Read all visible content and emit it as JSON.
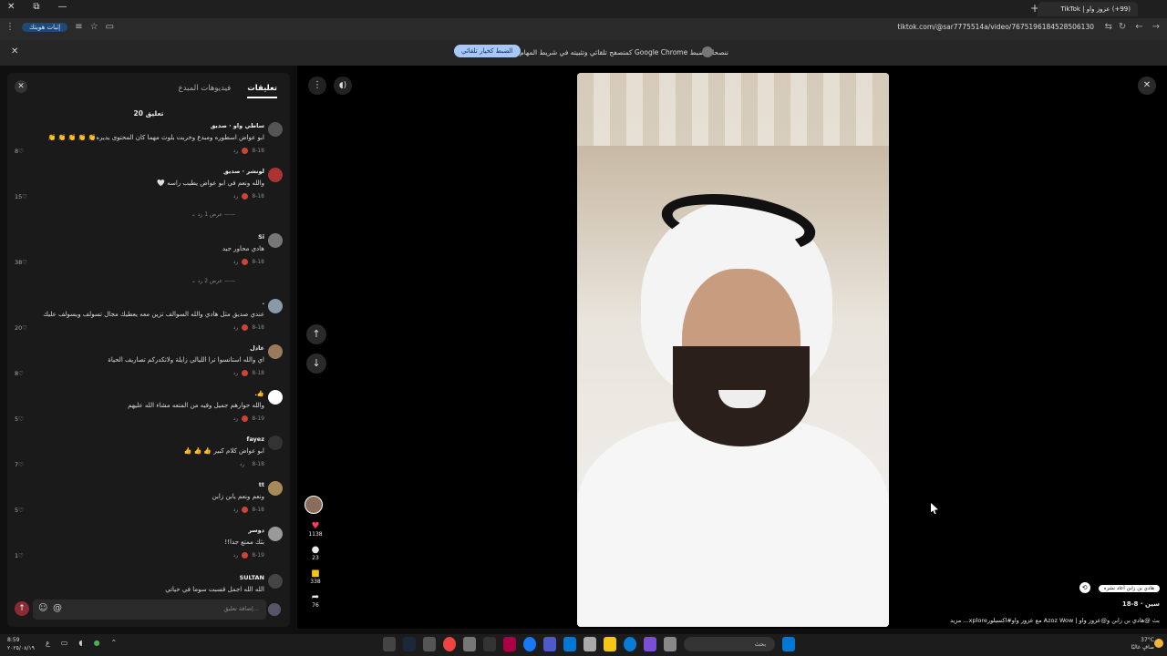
{
  "browser": {
    "tab_title": "(99+) عزوز واو | TikTok",
    "url": "tiktok.com/@sar7775514a/video/7675196184528506130",
    "verify_label": "إثبات هويتك"
  },
  "notification": {
    "message": "ننصحك بضبط Google Chrome كمتصفح تلقائي وتثبيته في شريط المهام",
    "button": "الضبط كخيار تلقائي"
  },
  "comments_panel": {
    "tab_comments": "تعليقات",
    "tab_creator_videos": "فيديوهات المبدع",
    "count_label": "20 تعليق",
    "reply_label": "رد",
    "input_placeholder": "إضافة تعليق...",
    "comments": [
      {
        "name": "ساطي واو · صديق",
        "text": "ابو عواض اسطوره ومبدع وخربت بلوث مهما كان المحتوى يديره👏 👏 👏 👏 👏",
        "date": "8-18",
        "likes": "8"
      },
      {
        "name": "لونشر · صديق",
        "text": "والله ونعم في ابو عواض يطيب راسه 🤍",
        "date": "8-18",
        "likes": "15",
        "replies": "عرض 1 رد"
      },
      {
        "name": "Si",
        "text": "هادي محاور جيد",
        "date": "8-18",
        "likes": "38",
        "replies": "عرض 2 رد"
      },
      {
        "name": ".",
        "text": "عندي صديق مثل هادي والله السوالف تزين معه يعطيك مجال تسولف ويسولف عليك",
        "date": "8-18",
        "likes": "20"
      },
      {
        "name": "عادل",
        "text": "اي والله استانسوا ترا الليالي زايلة ولاتكدركم تصاريف الحياة",
        "date": "8-18",
        "likes": "8"
      },
      {
        "name": "👍.",
        "text": "والله حوارهم جميل وفيه من المتعه مشاء الله عليهم",
        "date": "8-19",
        "likes": "5"
      },
      {
        "name": "fayez",
        "text": "ابو عواض كلام كبير 👍 👍 👍",
        "date": "8-18",
        "likes": "7"
      },
      {
        "name": "tt",
        "text": "ونعم ونعم يابن زابن",
        "date": "8-18",
        "likes": "5"
      },
      {
        "name": "دوسر",
        "text": "بثك ممتع جدا!!",
        "date": "8-19",
        "likes": "1"
      },
      {
        "name": "SULTAN",
        "text": "الله الله اجمل قسبت سوما في حياتي",
        "date": "",
        "likes": ""
      }
    ]
  },
  "video": {
    "actions": {
      "likes": "1138",
      "comments": "23",
      "saves": "338",
      "shares": "76"
    },
    "repost_label": "هادي بن زابن أعاد نشره",
    "author": "سين · 8-18",
    "caption": "بث @هادي بن زابن و@عزوز واو | Azoz Wow مع عزوز واو#اكسبلورxplore... مزيد"
  },
  "taskbar": {
    "search_label": "بحث",
    "weather": "37°C",
    "weather_desc": "صافٍ غالبًا",
    "time": "8:59",
    "date": "٢٠٢٥/٠٨/١٩",
    "lang": "ع"
  }
}
